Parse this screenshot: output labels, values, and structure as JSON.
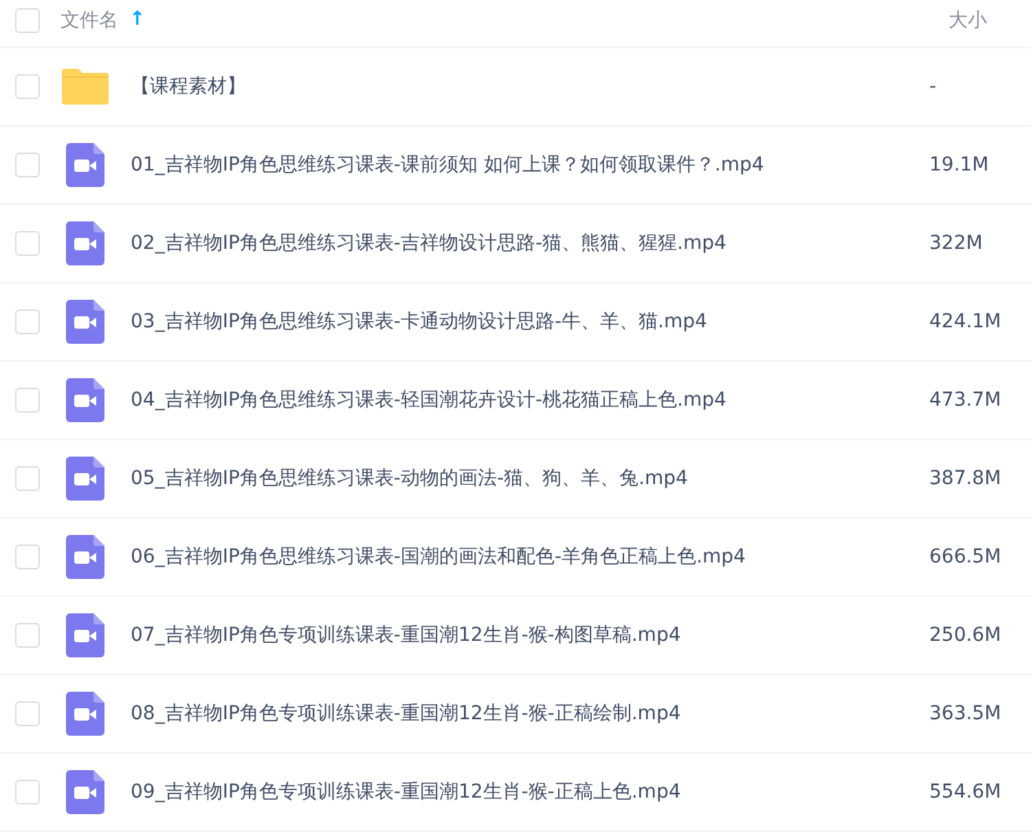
{
  "header": {
    "select_all": {
      "checked": false
    },
    "name_label": "文件名",
    "sort_arrow": "↑",
    "size_label": "大小"
  },
  "files": [
    {
      "kind": "folder",
      "name": "【课程素材】",
      "size": "-",
      "checked": false
    },
    {
      "kind": "video",
      "name": "01_吉祥物IP角色思维练习课表-课前须知 如何上课？如何领取课件？.mp4",
      "size": "19.1M",
      "checked": false
    },
    {
      "kind": "video",
      "name": "02_吉祥物IP角色思维练习课表-吉祥物设计思路-猫、熊猫、猩猩.mp4",
      "size": "322M",
      "checked": false
    },
    {
      "kind": "video",
      "name": "03_吉祥物IP角色思维练习课表-卡通动物设计思路-牛、羊、猫.mp4",
      "size": "424.1M",
      "checked": false
    },
    {
      "kind": "video",
      "name": "04_吉祥物IP角色思维练习课表-轻国潮花卉设计-桃花猫正稿上色.mp4",
      "size": "473.7M",
      "checked": false
    },
    {
      "kind": "video",
      "name": "05_吉祥物IP角色思维练习课表-动物的画法-猫、狗、羊、兔.mp4",
      "size": "387.8M",
      "checked": false
    },
    {
      "kind": "video",
      "name": "06_吉祥物IP角色思维练习课表-国潮的画法和配色-羊角色正稿上色.mp4",
      "size": "666.5M",
      "checked": false
    },
    {
      "kind": "video",
      "name": "07_吉祥物IP角色专项训练课表-重国潮12生肖-猴-构图草稿.mp4",
      "size": "250.6M",
      "checked": false
    },
    {
      "kind": "video",
      "name": "08_吉祥物IP角色专项训练课表-重国潮12生肖-猴-正稿绘制.mp4",
      "size": "363.5M",
      "checked": false
    },
    {
      "kind": "video",
      "name": "09_吉祥物IP角色专项训练课表-重国潮12生肖-猴-正稿上色.mp4",
      "size": "554.6M",
      "checked": false
    }
  ]
}
